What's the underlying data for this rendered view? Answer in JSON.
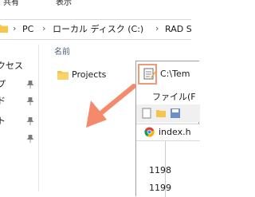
{
  "ribbon": {
    "tabs": [
      "共有",
      "表示"
    ]
  },
  "address": {
    "crumbs": [
      "PC",
      "ローカル ディスク (C:)",
      "RAD S"
    ]
  },
  "nav": {
    "items": [
      {
        "label": "クセス",
        "pinned": false
      },
      {
        "label": "プ",
        "pinned": true
      },
      {
        "label": "ド",
        "pinned": true
      },
      {
        "label": "ト",
        "pinned": true
      },
      {
        "label": "",
        "pinned": true
      }
    ]
  },
  "content": {
    "column_header": "名前",
    "items": [
      {
        "name": "Projects",
        "icon": "folder-icon"
      }
    ]
  },
  "editor_window": {
    "title": "C:\\Tem",
    "menu_label": "ファイル(F",
    "tab_label": "index.h",
    "line_numbers": [
      "1198",
      "1199"
    ]
  },
  "colors": {
    "arrow": "#f4896b",
    "highlight": "#f09977",
    "folder": "#f4c650"
  }
}
